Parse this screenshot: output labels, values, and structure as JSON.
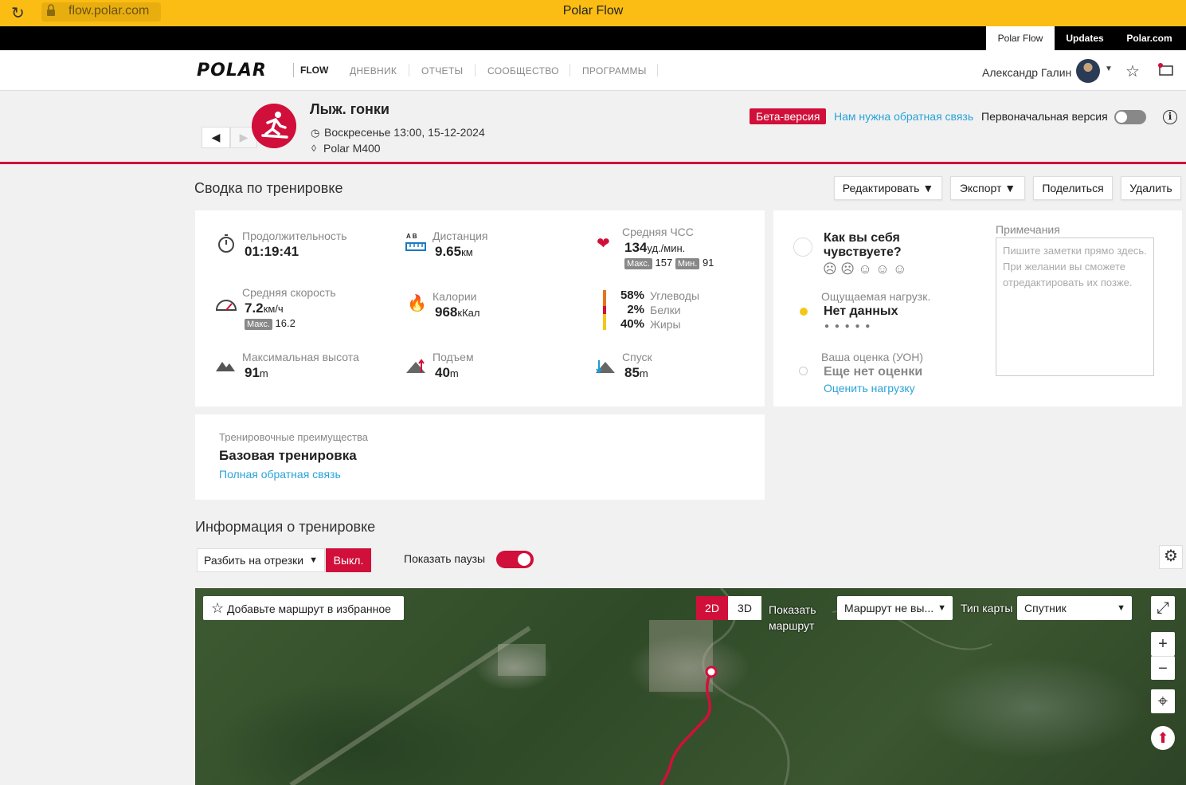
{
  "browser": {
    "url": "flow.polar.com",
    "window_title": "Polar Flow"
  },
  "top_tabs": [
    "Polar Flow",
    "Updates",
    "Polar.com"
  ],
  "nav": {
    "logo": "POLAR",
    "logo_sub": "FLOW",
    "items": [
      "ДНЕВНИК",
      "ОТЧЕТЫ",
      "СООБЩЕСТВО",
      "ПРОГРАММЫ"
    ],
    "user_name": "Александр Галин"
  },
  "session": {
    "prev": "◀",
    "next": "▶",
    "sport": "Лыж. гонки",
    "datetime": "Воскресенье 13:00, 15-12-2024",
    "device": "Polar M400",
    "beta_label": "Бета-версия",
    "feedback_link": "Нам нужна обратная связь",
    "original_version_label": "Первоначальная версия",
    "original_version_on": false
  },
  "summary": {
    "title": "Сводка по тренировке",
    "buttons": {
      "edit": "Редактировать ▼",
      "export": "Экспорт ▼",
      "share": "Поделиться",
      "delete": "Удалить"
    },
    "duration": {
      "label": "Продолжительность",
      "value": "01:19:41"
    },
    "distance": {
      "label": "Дистанция",
      "value": "9.65",
      "unit": "км",
      "icon_letters": "A  B"
    },
    "hr": {
      "label": "Средняя ЧСС",
      "value": "134",
      "unit": "уд./мин.",
      "max_label": "Макс.",
      "max": "157",
      "min_label": "Мин.",
      "min": "91"
    },
    "speed": {
      "label": "Средняя скорость",
      "value": "7.2",
      "unit": "км/ч",
      "max_label": "Макс.",
      "max": "16.2"
    },
    "calories": {
      "label": "Калории",
      "value": "968",
      "unit": "кКал"
    },
    "fuel": [
      {
        "pct": "58%",
        "label": "Углеводы",
        "color": "#e8731c"
      },
      {
        "pct": "2%",
        "label": "Белки",
        "color": "#d0103a"
      },
      {
        "pct": "40%",
        "label": "Жиры",
        "color": "#f5c61a"
      }
    ],
    "altitude": {
      "label": "Максимальная высота",
      "value": "91",
      "unit": "m"
    },
    "ascent": {
      "label": "Подъем",
      "value": "40",
      "unit": "m"
    },
    "descent": {
      "label": "Спуск",
      "value": "85",
      "unit": "m"
    }
  },
  "feelings": {
    "question": "Как вы себя чувствуете?",
    "faces": [
      "☹",
      "☹",
      "☺",
      "☺",
      "☺"
    ],
    "perceived_label": "Ощущаемая нагрузк.",
    "perceived_value": "Нет данных",
    "perceived_dots": "● ● ● ● ●",
    "rating_label": "Ваша оценка (УОН)",
    "rating_value": "Еще нет оценки",
    "rating_link": "Оценить нагрузку",
    "notes_label": "Примечания",
    "notes_placeholder": "Пишите заметки прямо здесь. При желании вы сможете отредактировать их позже."
  },
  "benefit": {
    "label": "Тренировочные преимущества",
    "value": "Базовая тренировка",
    "link": "Полная обратная связь"
  },
  "info": {
    "title": "Информация о тренировке",
    "split_select": "Разбить на отрезки",
    "off_button": "Выкл.",
    "pauses_label": "Показать паузы",
    "pauses_on": true
  },
  "map": {
    "favorite_button": "Добавьте маршрут в избранное",
    "mode_2d": "2D",
    "mode_3d": "3D",
    "show_route": "Показать маршрут",
    "route_select": "Маршрут не вы...",
    "map_type_label": "Тип карты",
    "map_type_select": "Спутник",
    "zoom_in": "+",
    "zoom_out": "−"
  },
  "colors": {
    "brand_red": "#d0103a",
    "browser_bar": "#fbbd14",
    "link_blue": "#2aa3d8"
  }
}
